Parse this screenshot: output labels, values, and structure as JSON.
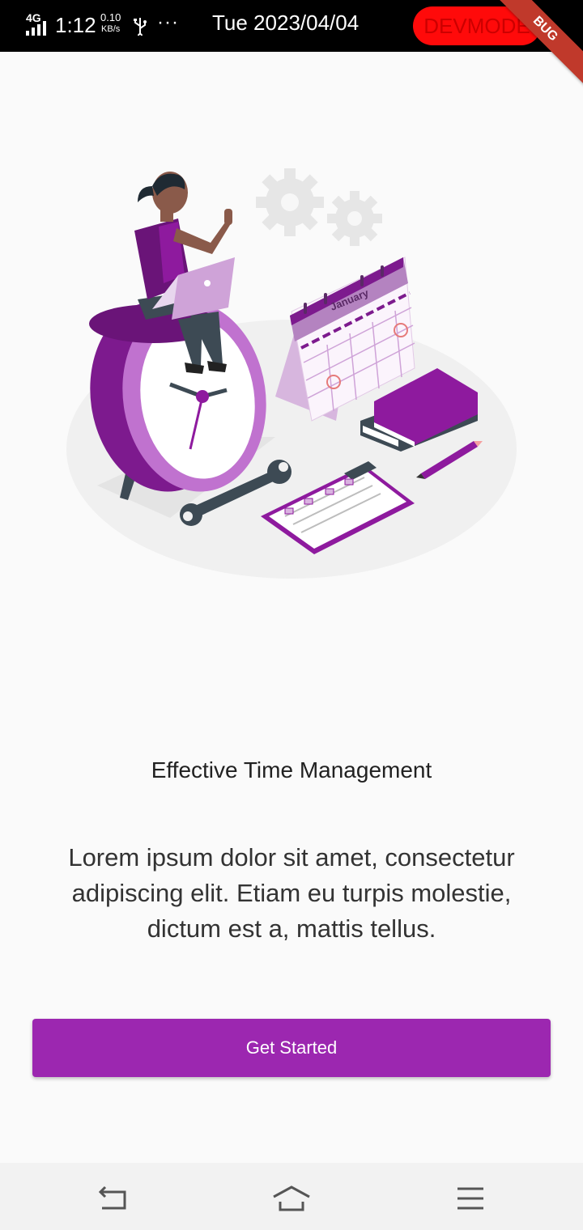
{
  "status_bar": {
    "network": "4G",
    "time": "1:12",
    "speed_value": "0.10",
    "speed_unit": "KB/s",
    "more": "···",
    "date": "Tue 2023/04/04",
    "devmode_label": "DEVMODE",
    "debug_banner": "BUG"
  },
  "illustration": {
    "calendar_month": "January",
    "accent_color": "#8e1a9e",
    "icons": [
      "woman-with-laptop",
      "alarm-clock",
      "gear-icon",
      "calendar-icon",
      "books",
      "pencil",
      "wrench",
      "clipboard"
    ]
  },
  "onboarding": {
    "title": "Effective Time Management",
    "description": "Lorem ipsum dolor sit amet, consectetur adipiscing elit. Etiam eu turpis molestie, dictum est a, mattis tellus.",
    "button_label": "Get Started",
    "button_color": "#9c27b0"
  },
  "nav_bar": {
    "icons": [
      "back-icon",
      "home-icon",
      "menu-icon"
    ]
  }
}
